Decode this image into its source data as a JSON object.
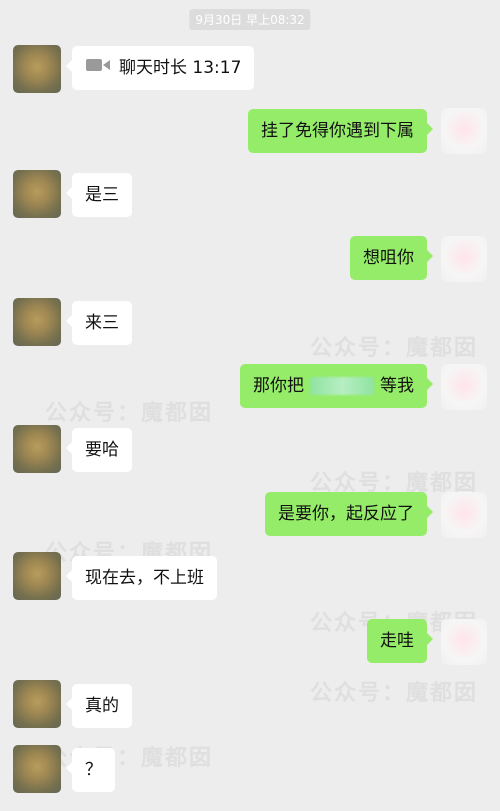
{
  "timestamp": "9月30日 早上08:32",
  "messages": [
    {
      "side": "left",
      "text": "聊天时长 13:17",
      "icon": "video-call-icon"
    },
    {
      "side": "right",
      "text": "挂了免得你遇到下属"
    },
    {
      "side": "left",
      "text": "是三"
    },
    {
      "side": "right",
      "text": "想咀你"
    },
    {
      "side": "left",
      "text": "来三"
    },
    {
      "side": "right",
      "text_before": "那你把",
      "text_after": "等我"
    },
    {
      "side": "left",
      "text": "要哈"
    },
    {
      "side": "right",
      "text": "是要你，起反应了"
    },
    {
      "side": "left",
      "text": "现在去，不上班"
    },
    {
      "side": "right",
      "text": "走哇"
    },
    {
      "side": "left",
      "text": "真的"
    },
    {
      "side": "left",
      "text": "？"
    }
  ],
  "watermark": "公众号：魔都囡"
}
